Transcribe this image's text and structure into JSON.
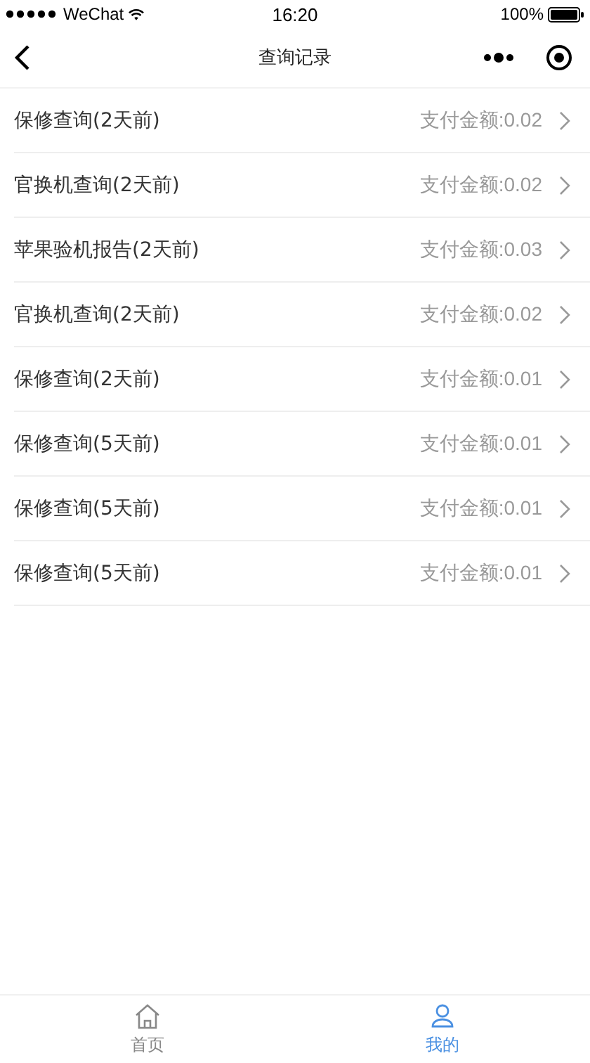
{
  "status_bar": {
    "carrier": "WeChat",
    "time": "16:20",
    "battery": "100%"
  },
  "nav": {
    "title": "查询记录"
  },
  "records": [
    {
      "name": "保修查询(2天前)",
      "amount": "支付金额:0.02"
    },
    {
      "name": "官换机查询(2天前)",
      "amount": "支付金额:0.02"
    },
    {
      "name": "苹果验机报告(2天前)",
      "amount": "支付金额:0.03"
    },
    {
      "name": "官换机查询(2天前)",
      "amount": "支付金额:0.02"
    },
    {
      "name": "保修查询(2天前)",
      "amount": "支付金额:0.01"
    },
    {
      "name": "保修查询(5天前)",
      "amount": "支付金额:0.01"
    },
    {
      "name": "保修查询(5天前)",
      "amount": "支付金额:0.01"
    },
    {
      "name": "保修查询(5天前)",
      "amount": "支付金额:0.01"
    }
  ],
  "tab_bar": [
    {
      "kind": "home",
      "label": "首页",
      "selected": false
    },
    {
      "kind": "profile",
      "label": "我的",
      "selected": true
    }
  ]
}
